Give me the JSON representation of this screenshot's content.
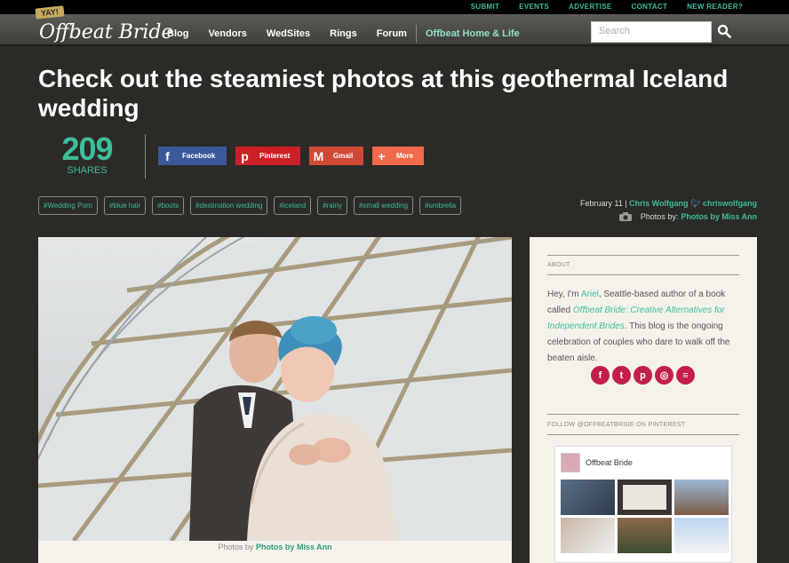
{
  "topbar": {
    "links": [
      "SUBMIT",
      "EVENTS",
      "ADVERTISE",
      "CONTACT",
      "NEW READER?"
    ]
  },
  "logo": {
    "badge": "YAY!",
    "wordmark": "Offbeat Bride"
  },
  "nav": {
    "items": [
      "Blog",
      "Vendors",
      "WedSites",
      "Rings",
      "Forum"
    ],
    "home_link": "Offbeat Home & Life"
  },
  "search": {
    "placeholder": "Search"
  },
  "article": {
    "title": "Check out the steamiest photos at this geothermal Iceland wedding",
    "shares_count": "209",
    "shares_label": "SHARES",
    "share_buttons": [
      {
        "label": "Facebook",
        "icon": "f",
        "color": "#3b5998"
      },
      {
        "label": "Pinterest",
        "icon": "p",
        "color": "#cb2027"
      },
      {
        "label": "Gmail",
        "icon": "M",
        "color": "#d14836"
      },
      {
        "label": "More",
        "icon": "+",
        "color": "#f0694b"
      }
    ],
    "tags": [
      "#Wedding Porn",
      "#blue hair",
      "#boots",
      "#destination wedding",
      "#iceland",
      "#rainy",
      "#small wedding",
      "#umbrella"
    ],
    "date": "February 11",
    "author": "Chris Wolfgang",
    "twitter": "chriswolfgang",
    "photos_by_label": "Photos by:",
    "photographer": "Photos by Miss Ann",
    "caption_prefix": "Photos by",
    "caption_link": "Photos by Miss Ann"
  },
  "sidebar": {
    "about_heading": "ABOUT",
    "about_intro": "Hey, I'm ",
    "about_name": "Ariel",
    "about_mid": ", Seattle-based author of a book called ",
    "about_book": "Offbeat Bride: Creative Alternatives for Independent Brides",
    "about_end": ". This blog is the ongoing celebration of couples who dare to walk off the beaten aisle.",
    "social_icons": [
      "facebook-icon",
      "twitter-icon",
      "pinterest-icon",
      "instagram-icon",
      "rss-icon"
    ],
    "pinterest_heading": "FOLLOW @OFFBEATBRIDE ON PINTEREST",
    "pinterest_name": "Offbeat Bride"
  },
  "colors": {
    "accent": "#3ebd9b",
    "background": "#2b2a26",
    "social": "#c41e4a"
  }
}
